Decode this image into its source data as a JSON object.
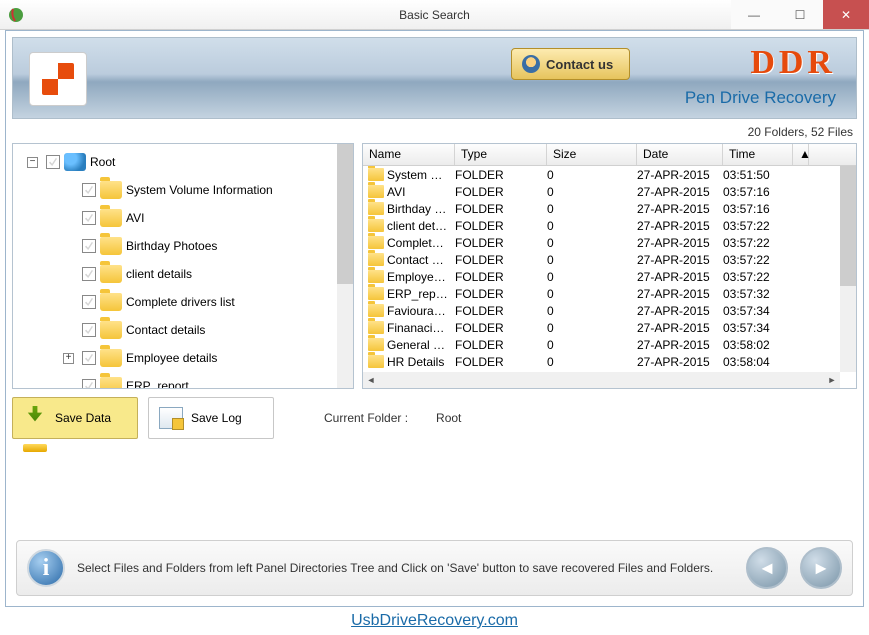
{
  "window": {
    "title": "Basic Search"
  },
  "banner": {
    "contact_label": "Contact us",
    "brand": "DDR",
    "subtitle": "Pen Drive Recovery"
  },
  "stats": "20 Folders, 52 Files",
  "tree": {
    "root_label": "Root",
    "items": [
      {
        "label": "System Volume Information",
        "expand": null
      },
      {
        "label": "AVI",
        "expand": null
      },
      {
        "label": "Birthday Photoes",
        "expand": null
      },
      {
        "label": "client details",
        "expand": null
      },
      {
        "label": "Complete drivers list",
        "expand": null
      },
      {
        "label": "Contact details",
        "expand": null
      },
      {
        "label": "Employee details",
        "expand": "+"
      },
      {
        "label": "ERP_report",
        "expand": null
      }
    ]
  },
  "list": {
    "headers": {
      "name": "Name",
      "type": "Type",
      "size": "Size",
      "date": "Date",
      "time": "Time"
    },
    "rows": [
      {
        "name": "System Volu...",
        "type": "FOLDER",
        "size": "0",
        "date": "27-APR-2015",
        "time": "03:51:50"
      },
      {
        "name": "AVI",
        "type": "FOLDER",
        "size": "0",
        "date": "27-APR-2015",
        "time": "03:57:16"
      },
      {
        "name": "Birthday Pho...",
        "type": "FOLDER",
        "size": "0",
        "date": "27-APR-2015",
        "time": "03:57:16"
      },
      {
        "name": "client details",
        "type": "FOLDER",
        "size": "0",
        "date": "27-APR-2015",
        "time": "03:57:22"
      },
      {
        "name": "Complete dri...",
        "type": "FOLDER",
        "size": "0",
        "date": "27-APR-2015",
        "time": "03:57:22"
      },
      {
        "name": "Contact details",
        "type": "FOLDER",
        "size": "0",
        "date": "27-APR-2015",
        "time": "03:57:22"
      },
      {
        "name": "Employee de...",
        "type": "FOLDER",
        "size": "0",
        "date": "27-APR-2015",
        "time": "03:57:22"
      },
      {
        "name": "ERP_report",
        "type": "FOLDER",
        "size": "0",
        "date": "27-APR-2015",
        "time": "03:57:32"
      },
      {
        "name": "Faviourate P...",
        "type": "FOLDER",
        "size": "0",
        "date": "27-APR-2015",
        "time": "03:57:34"
      },
      {
        "name": "Finanacial R...",
        "type": "FOLDER",
        "size": "0",
        "date": "27-APR-2015",
        "time": "03:57:34"
      },
      {
        "name": "General Doc...",
        "type": "FOLDER",
        "size": "0",
        "date": "27-APR-2015",
        "time": "03:58:02"
      },
      {
        "name": "HR Details",
        "type": "FOLDER",
        "size": "0",
        "date": "27-APR-2015",
        "time": "03:58:04"
      }
    ]
  },
  "actions": {
    "save": "Save Data",
    "log": "Save Log"
  },
  "current_folder": {
    "label": "Current Folder :",
    "value": "Root"
  },
  "hint": "Select Files and Folders from left Panel Directories Tree and Click on 'Save' button to save recovered Files and Folders.",
  "footer": "UsbDriveRecovery.com"
}
